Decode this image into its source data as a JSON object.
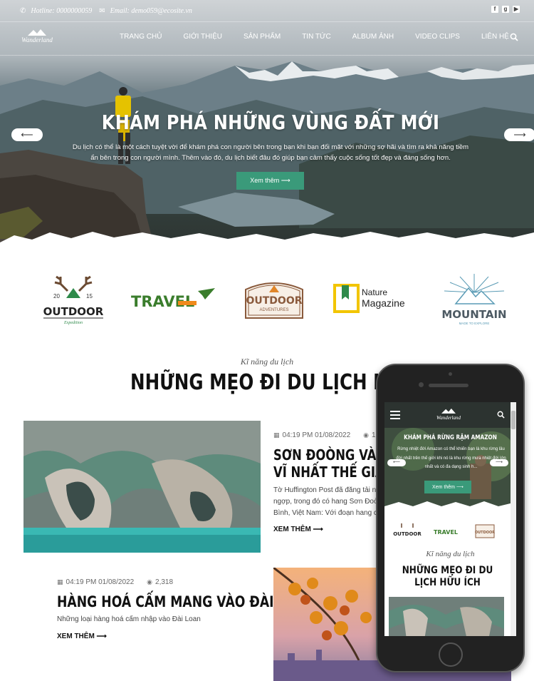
{
  "topbar": {
    "hotline": "Hotline: 0000000059",
    "email": "Email: demo059@ecosite.vn",
    "social_icons": [
      "facebook-icon",
      "google-plus-icon",
      "youtube-icon"
    ]
  },
  "logo": {
    "text": "Wanderland"
  },
  "nav": {
    "items": [
      "TRANG CHỦ",
      "GIỚI THIỆU",
      "SẢN PHẨM",
      "TIN TỨC",
      "ALBUM ẢNH",
      "VIDEO CLIPS",
      "LIÊN HỆ"
    ]
  },
  "hero": {
    "title": "KHÁM PHÁ NHỮNG VÙNG ĐẤT MỚI",
    "description": "Du lịch có thể là một cách tuyệt vời để khám phá con người bên trong bạn khi bạn đối mặt với những sợ hãi và tìm ra khả năng tiềm ẩn bên trong con người mình. Thêm vào đó, du lịch biết đâu đó giúp bạn cảm thấy cuộc sống tốt đẹp và đáng sống hơn.",
    "button": "Xem thêm ⟶"
  },
  "brands": {
    "outdoor_year_left": "20",
    "outdoor_year_right": "15",
    "outdoor": "OUTDOOR",
    "outdoor_sub": "Expedition",
    "travel": "TRAVEL",
    "outdoor2": "OUTDOOR",
    "outdoor2_sub": "ADVENTURES",
    "nature_1": "Nature",
    "nature_2": "Magazine",
    "mountain": "MOUNTAIN",
    "mountain_sub": "MADE TO EXPLORE"
  },
  "section": {
    "kicker": "Kĩ năng du lịch",
    "title": "NHỮNG MẸO ĐI DU LỊCH HỮU ÍCH"
  },
  "posts": [
    {
      "datetime": "04:19 PM 01/08/2022",
      "views": "1,139",
      "title_line1": "SƠN ĐOÒNG VÀO TOP",
      "title_line2": "VĨ NHẤT THẾ GIAN",
      "excerpt_line1": "Tờ Huffington Post đã đăng tải những",
      "excerpt_line2": "ngợp, trong đó có hang Sơn Đoòng củ",
      "excerpt_line3": "Bình, Việt Nam: Với đoạn hang chính",
      "more": "XEM THÊM ⟶"
    },
    {
      "datetime": "04:19 PM 01/08/2022",
      "views": "2,318",
      "title": "HÀNG HOÁ CẤM MANG VÀO ĐÀI LOAN",
      "excerpt": "Những loại hàng hoá cấm nhập vào Đài Loan",
      "more": "XEM THÊM ⟶"
    }
  ],
  "mobile": {
    "hero_title": "KHÁM PHÁ RỪNG RẬM AMAZON",
    "hero_desc": "Rừng nhiệt đới Amazon có thể khiến bạn là khu rừng lâu đời nhất trên thế giới khi nó là khu rừng mưa nhiệt đới lớn nhất và có đa dạng sinh h...",
    "button": "Xem thêm ⟶",
    "kicker": "Kĩ năng du lịch",
    "section_title": "NHỮNG MẸO ĐI DU LỊCH HỮU ÍCH",
    "brand_outdoor": "OUTDOOR",
    "brand_travel": "TRAVEL",
    "brand_outdoor2": "OUTDOOR"
  },
  "colors": {
    "accent": "#3a9a7a",
    "travel_green": "#3a7d2c",
    "travel_orange": "#f08a1c",
    "nature_yellow": "#f2c500",
    "outdoor_brown": "#8a5a3c"
  }
}
